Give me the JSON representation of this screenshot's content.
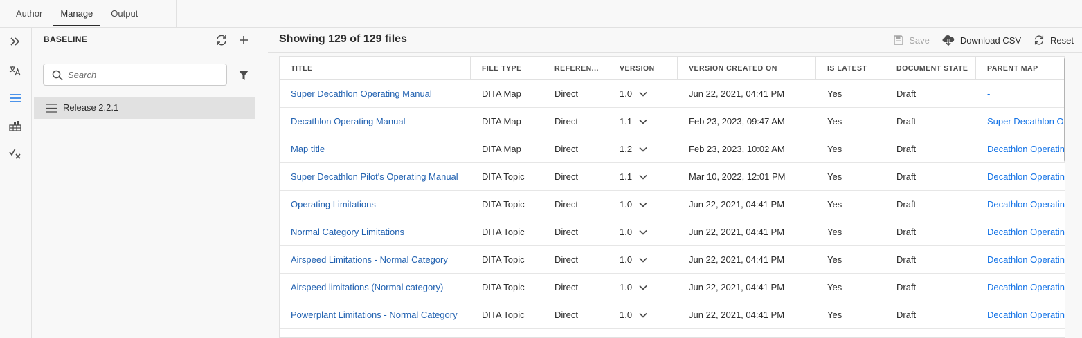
{
  "tabs": [
    {
      "label": "Author",
      "active": false
    },
    {
      "label": "Manage",
      "active": true
    },
    {
      "label": "Output",
      "active": false
    }
  ],
  "rail": {
    "icons": [
      "expand-icon",
      "translate-icon",
      "baseline-icon",
      "reports-icon",
      "validate-icon"
    ],
    "active": "baseline-icon"
  },
  "panel": {
    "title": "BASELINE",
    "search_placeholder": "Search",
    "items": [
      {
        "label": "Release 2.2.1",
        "selected": true
      }
    ]
  },
  "main": {
    "title": "Showing 129 of 129 files",
    "toolbar": {
      "save_label": "Save",
      "download_label": "Download CSV",
      "reset_label": "Reset"
    }
  },
  "table": {
    "columns": [
      "TITLE",
      "FILE TYPE",
      "REFEREN...",
      "VERSION",
      "VERSION CREATED ON",
      "IS LATEST",
      "DOCUMENT STATE",
      "PARENT MAP"
    ],
    "rows": [
      {
        "title": "Super Decathlon Operating Manual",
        "file_type": "DITA Map",
        "reference": "Direct",
        "version": "1.0",
        "created": "Jun 22, 2021, 04:41 PM",
        "is_latest": "Yes",
        "state": "Draft",
        "parent_map": "-"
      },
      {
        "title": "Decathlon Operating Manual",
        "file_type": "DITA Map",
        "reference": "Direct",
        "version": "1.1",
        "created": "Feb 23, 2023, 09:47 AM",
        "is_latest": "Yes",
        "state": "Draft",
        "parent_map": "Super Decathlon Op"
      },
      {
        "title": "Map title",
        "file_type": "DITA Map",
        "reference": "Direct",
        "version": "1.2",
        "created": "Feb 23, 2023, 10:02 AM",
        "is_latest": "Yes",
        "state": "Draft",
        "parent_map": "Decathlon Operatin"
      },
      {
        "title": "Super Decathlon Pilot's Operating Manual",
        "file_type": "DITA Topic",
        "reference": "Direct",
        "version": "1.1",
        "created": "Mar 10, 2022, 12:01 PM",
        "is_latest": "Yes",
        "state": "Draft",
        "parent_map": "Decathlon Operatin"
      },
      {
        "title": "Operating Limitations",
        "file_type": "DITA Topic",
        "reference": "Direct",
        "version": "1.0",
        "created": "Jun 22, 2021, 04:41 PM",
        "is_latest": "Yes",
        "state": "Draft",
        "parent_map": "Decathlon Operatin"
      },
      {
        "title": "Normal Category Limitations",
        "file_type": "DITA Topic",
        "reference": "Direct",
        "version": "1.0",
        "created": "Jun 22, 2021, 04:41 PM",
        "is_latest": "Yes",
        "state": "Draft",
        "parent_map": "Decathlon Operatin"
      },
      {
        "title": "Airspeed Limitations - Normal Category",
        "file_type": "DITA Topic",
        "reference": "Direct",
        "version": "1.0",
        "created": "Jun 22, 2021, 04:41 PM",
        "is_latest": "Yes",
        "state": "Draft",
        "parent_map": "Decathlon Operatin"
      },
      {
        "title": "Airspeed limitations (Normal category)",
        "file_type": "DITA Topic",
        "reference": "Direct",
        "version": "1.0",
        "created": "Jun 22, 2021, 04:41 PM",
        "is_latest": "Yes",
        "state": "Draft",
        "parent_map": "Decathlon Operatin"
      },
      {
        "title": "Powerplant Limitations - Normal Category",
        "file_type": "DITA Topic",
        "reference": "Direct",
        "version": "1.0",
        "created": "Jun 22, 2021, 04:41 PM",
        "is_latest": "Yes",
        "state": "Draft",
        "parent_map": "Decathlon Operatin"
      }
    ]
  },
  "colors": {
    "link": "#2262b1",
    "accent": "#1473e6",
    "selected_bg": "#e1e1e1"
  }
}
